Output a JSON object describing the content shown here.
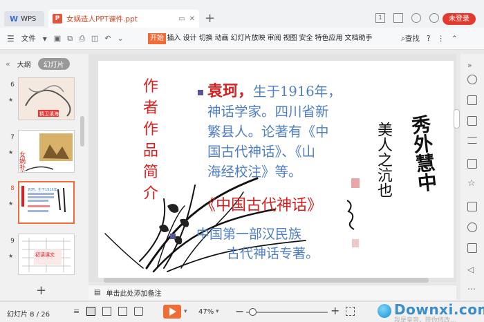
{
  "titlebar": {
    "app_tab_label": "WPS",
    "doc_tab_label": "女娲造人PPT课件.ppt",
    "page_badge": "1",
    "login_label": "未登录"
  },
  "ribbon": {
    "file_label": "文件",
    "tabs": [
      "开始",
      "插入",
      "设计",
      "切换",
      "动画",
      "幻灯片放映",
      "审阅",
      "视图",
      "安全",
      "特色应用",
      "文档助手"
    ],
    "search_label": "查找",
    "help_label": "?"
  },
  "left_panel": {
    "tab_outline": "大纲",
    "tab_slides": "幻灯片",
    "thumbnails": [
      {
        "num": "6",
        "caption": "精卫填海"
      },
      {
        "num": "7",
        "caption": "女娲补天"
      },
      {
        "num": "8",
        "caption": "袁珂，生于1916年"
      },
      {
        "num": "9",
        "caption": "初读课文"
      }
    ]
  },
  "slide": {
    "vertical_title": [
      "作",
      "者",
      "作",
      "品",
      "简",
      "介"
    ],
    "line1_name": "袁珂，",
    "line1_rest": "生于1916年，",
    "lines": [
      "神话学家。四川省新",
      "繁县人。论著有《中",
      "国古代神话》、《山",
      "海经校注》等。"
    ],
    "book_title": "《中国古代神话》",
    "desc_line1": "中国第一部汉民族",
    "desc_line2": "古代神话专著。",
    "calligraphy_col1": "秀外慧中",
    "calligraphy_col2": "美人之沆也"
  },
  "notes": {
    "placeholder": "单击此处添加备注"
  },
  "status": {
    "slide_count": "幻灯片 8 / 26",
    "zoom": "47%",
    "zoom_level_fraction": 0.08
  },
  "watermark": {
    "text": "Downxi.com",
    "subtext": "我是皇帝，陛你修改..."
  },
  "colors": {
    "accent": "#f06b35",
    "login_red": "#e33a2f",
    "slide_red": "#e21c1c",
    "slide_blue": "#4f7fc2"
  }
}
